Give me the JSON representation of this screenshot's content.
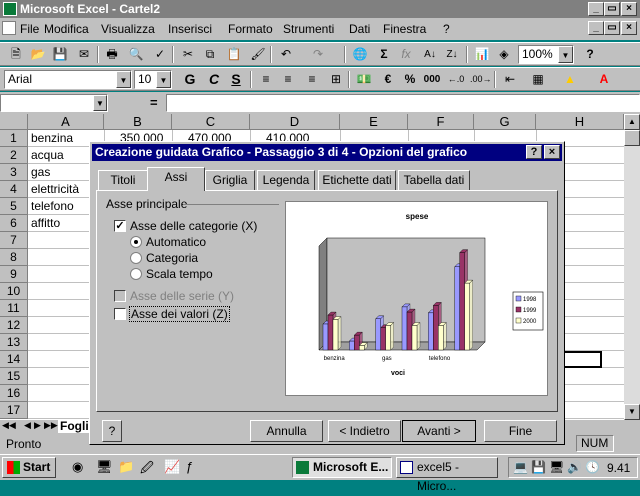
{
  "window": {
    "title": "Microsoft Excel - Cartel2",
    "controls": [
      "_",
      "×"
    ]
  },
  "menu": [
    "File",
    "Modifica",
    "Visualizza",
    "Inserisci",
    "Formato",
    "Strumenti",
    "Dati",
    "Finestra",
    "?"
  ],
  "toolbar": {
    "zoom": "100%",
    "font": "Arial",
    "size": "10",
    "sigma": "Σ",
    "fx": "fx",
    "bold": "G",
    "italic": "C",
    "underline": "S",
    "currency": "€",
    "percent": "%",
    "thousands": "000",
    "dec_inc": "⁰⁰",
    "help": "?"
  },
  "formula": {
    "eq": "="
  },
  "grid": {
    "columns": [
      "A",
      "B",
      "C",
      "D",
      "E",
      "F",
      "G",
      "H"
    ],
    "rows": [
      "1",
      "2",
      "3",
      "4",
      "5",
      "6",
      "7",
      "8",
      "9",
      "10",
      "11",
      "12",
      "13",
      "14",
      "15",
      "16",
      "17"
    ],
    "colA": [
      "benzina",
      "acqua",
      "gas",
      "elettricità",
      "telefono",
      "affitto"
    ],
    "row1_values": [
      "350.000",
      "470.000",
      "410.000"
    ]
  },
  "sheet_tab": "Foglio",
  "status": {
    "text": "Pronto",
    "num": "NUM"
  },
  "taskbar": {
    "start": "Start",
    "tasks": [
      "Microsoft E...",
      "excel5 - Micro..."
    ],
    "clock": "9.41"
  },
  "dialog": {
    "title": "Creazione guidata Grafico - Passaggio 3 di 4 - Opzioni del grafico",
    "title_buttons": [
      "?",
      "×"
    ],
    "tabs": [
      "Titoli",
      "Assi",
      "Griglia",
      "Legenda",
      "Etichette dati",
      "Tabella dati"
    ],
    "active_tab": "Assi",
    "group_label": "Asse principale",
    "category_axis": {
      "label": "Asse delle categorie (X)",
      "checked": true
    },
    "radios": [
      {
        "label": "Automatico",
        "selected": true
      },
      {
        "label": "Categoria",
        "selected": false
      },
      {
        "label": "Scala tempo",
        "selected": false
      }
    ],
    "series_axis": {
      "label": "Asse delle serie (Y)",
      "checked": false,
      "disabled": true
    },
    "value_axis": {
      "label": "Asse dei valori (Z)",
      "checked": false
    },
    "buttons": {
      "help": "?",
      "cancel": "Annulla",
      "back": "< Indietro",
      "next": "Avanti >",
      "finish": "Fine"
    }
  },
  "chart_data": {
    "type": "bar",
    "title": "spese",
    "xlabel": "voci",
    "categories": [
      "benzina",
      "acqua",
      "gas",
      "elettricità",
      "telefono",
      "affitto"
    ],
    "x_tick_labels": [
      "benzina",
      "gas",
      "telefono"
    ],
    "series": [
      {
        "name": "1998",
        "values": [
          350,
          120,
          420,
          580,
          500,
          1120
        ],
        "color": "#9999ff"
      },
      {
        "name": "1999",
        "values": [
          470,
          200,
          300,
          510,
          600,
          1310
        ],
        "color": "#993366"
      },
      {
        "name": "2000",
        "values": [
          410,
          60,
          330,
          330,
          330,
          900
        ],
        "color": "#ffffcc"
      }
    ],
    "legend_position": "right",
    "grid": false
  }
}
